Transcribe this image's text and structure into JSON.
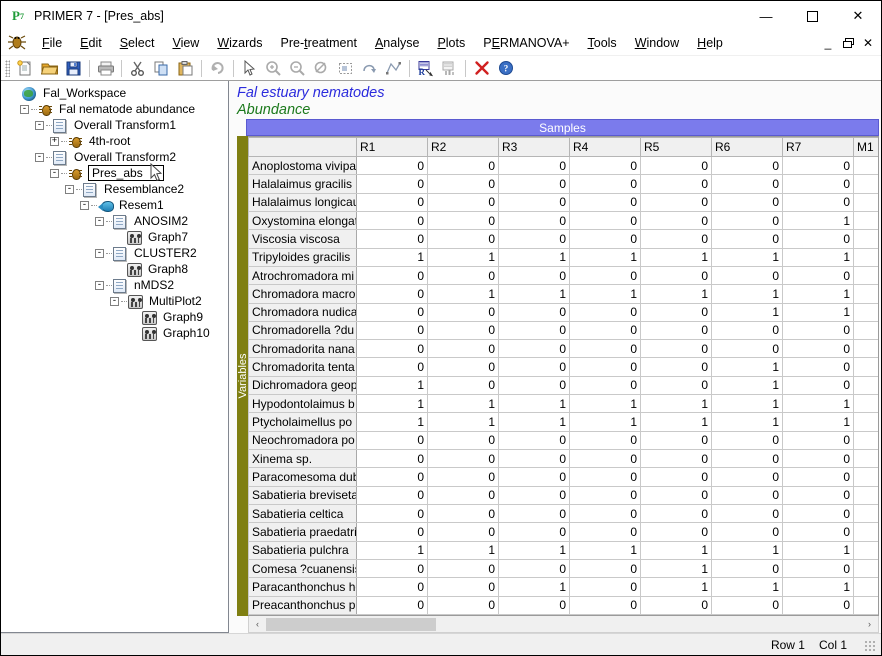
{
  "window": {
    "title": "PRIMER 7 - [Pres_abs]",
    "logo_text": "P",
    "logo_sub": "7",
    "minimize": "—",
    "maximize": "☐",
    "close": "✕"
  },
  "menubar": {
    "items": [
      {
        "pre": "",
        "accel": "F",
        "post": "ile",
        "name": "file"
      },
      {
        "pre": "",
        "accel": "E",
        "post": "dit",
        "name": "edit"
      },
      {
        "pre": "",
        "accel": "S",
        "post": "elect",
        "name": "select"
      },
      {
        "pre": "",
        "accel": "V",
        "post": "iew",
        "name": "view"
      },
      {
        "pre": "",
        "accel": "W",
        "post": "izards",
        "name": "wizards"
      },
      {
        "pre": "Pre-",
        "accel": "t",
        "post": "reatment",
        "name": "pre-treatment"
      },
      {
        "pre": "",
        "accel": "A",
        "post": "nalyse",
        "name": "analyse"
      },
      {
        "pre": "",
        "accel": "P",
        "post": "lots",
        "name": "plots"
      },
      {
        "pre": "P",
        "accel": "E",
        "post": "RMANOVA+",
        "name": "permanova"
      },
      {
        "pre": "",
        "accel": "T",
        "post": "ools",
        "name": "tools"
      },
      {
        "pre": "",
        "accel": "W",
        "post": "indow",
        "name": "window"
      },
      {
        "pre": "",
        "accel": "H",
        "post": "elp",
        "name": "help"
      }
    ],
    "mdi_minimize": "_",
    "mdi_restore": "❐",
    "mdi_close": "✕"
  },
  "toolbar": {
    "buttons": [
      {
        "name": "new-icon",
        "label": "New"
      },
      {
        "name": "open-icon",
        "label": "Open"
      },
      {
        "name": "save-icon",
        "label": "Save"
      },
      {
        "name": "print-icon",
        "label": "Print"
      },
      {
        "name": "cut-icon",
        "label": "Cut"
      },
      {
        "name": "copy-icon",
        "label": "Copy"
      },
      {
        "name": "paste-icon",
        "label": "Paste"
      },
      {
        "name": "undo-icon",
        "label": "Undo"
      },
      {
        "name": "pointer-icon",
        "label": "Select"
      },
      {
        "name": "zoom-in-icon",
        "label": "Zoom In"
      },
      {
        "name": "zoom-out-icon",
        "label": "Zoom Out"
      },
      {
        "name": "zoom-reset-icon",
        "label": "Zoom Reset"
      },
      {
        "name": "select-region-icon",
        "label": "Select Region"
      },
      {
        "name": "rotate-icon",
        "label": "Rotate"
      },
      {
        "name": "reshape-icon",
        "label": "Reshape"
      },
      {
        "name": "relabel-icon",
        "label": "Relabel"
      },
      {
        "name": "chart-icon",
        "label": "Chart"
      },
      {
        "name": "delete-icon",
        "label": "Delete"
      },
      {
        "name": "help-icon",
        "label": "Help"
      }
    ]
  },
  "tree": {
    "nodes": [
      {
        "label": "Fal_Workspace",
        "depth": 0,
        "icon": "globe",
        "expander": "",
        "selected": false
      },
      {
        "label": "Fal nematode abundance",
        "depth": 1,
        "icon": "bug",
        "expander": "-",
        "selected": false
      },
      {
        "label": "Overall Transform1",
        "depth": 2,
        "icon": "sheet",
        "expander": "-",
        "selected": false
      },
      {
        "label": "4th-root",
        "depth": 3,
        "icon": "bug",
        "expander": "+",
        "selected": false
      },
      {
        "label": "Overall Transform2",
        "depth": 2,
        "icon": "sheet",
        "expander": "-",
        "selected": false
      },
      {
        "label": "Pres_abs",
        "depth": 3,
        "icon": "bug",
        "expander": "-",
        "selected": true
      },
      {
        "label": "Resemblance2",
        "depth": 4,
        "icon": "sheet",
        "expander": "-",
        "selected": false
      },
      {
        "label": "Resem1",
        "depth": 5,
        "icon": "fish",
        "expander": "-",
        "selected": false
      },
      {
        "label": "ANOSIM2",
        "depth": 6,
        "icon": "sheet",
        "expander": "-",
        "selected": false
      },
      {
        "label": "Graph7",
        "depth": 7,
        "icon": "graph",
        "expander": "",
        "selected": false
      },
      {
        "label": "CLUSTER2",
        "depth": 6,
        "icon": "sheet",
        "expander": "-",
        "selected": false
      },
      {
        "label": "Graph8",
        "depth": 7,
        "icon": "graph",
        "expander": "",
        "selected": false
      },
      {
        "label": "nMDS2",
        "depth": 6,
        "icon": "sheet",
        "expander": "-",
        "selected": false
      },
      {
        "label": "MultiPlot2",
        "depth": 7,
        "icon": "graph",
        "expander": "-",
        "selected": false
      },
      {
        "label": "Graph9",
        "depth": 8,
        "icon": "graph",
        "expander": "",
        "selected": false
      },
      {
        "label": "Graph10",
        "depth": 8,
        "icon": "graph",
        "expander": "",
        "selected": false
      }
    ]
  },
  "document": {
    "title": "Fal estuary nematodes",
    "subtitle": "Abundance",
    "title_color": "#2b2bdd",
    "subtitle_color": "#1d7a1d"
  },
  "grid": {
    "samples_band_label": "Samples",
    "variables_label": "Variables",
    "band_color": "#7b7bec",
    "variables_color": "#7f7f12",
    "corner_header": "",
    "columns": [
      "R1",
      "R2",
      "R3",
      "R4",
      "R5",
      "R6",
      "R7",
      "M1"
    ],
    "rows": [
      {
        "label": "Anoplostoma vivipa",
        "values": [
          "0",
          "0",
          "0",
          "0",
          "0",
          "0",
          "0",
          ""
        ]
      },
      {
        "label": "Halalaimus gracilis",
        "values": [
          "0",
          "0",
          "0",
          "0",
          "0",
          "0",
          "0",
          ""
        ]
      },
      {
        "label": "Halalaimus longicau",
        "values": [
          "0",
          "0",
          "0",
          "0",
          "0",
          "0",
          "0",
          ""
        ]
      },
      {
        "label": "Oxystomina elongat",
        "values": [
          "0",
          "0",
          "0",
          "0",
          "0",
          "0",
          "1",
          ""
        ]
      },
      {
        "label": "Viscosia viscosa",
        "values": [
          "0",
          "0",
          "0",
          "0",
          "0",
          "0",
          "0",
          ""
        ]
      },
      {
        "label": "Tripyloides gracilis",
        "values": [
          "1",
          "1",
          "1",
          "1",
          "1",
          "1",
          "1",
          ""
        ]
      },
      {
        "label": "Atrochromadora mi",
        "values": [
          "0",
          "0",
          "0",
          "0",
          "0",
          "0",
          "0",
          ""
        ]
      },
      {
        "label": "Chromadora macro",
        "values": [
          "0",
          "1",
          "1",
          "1",
          "1",
          "1",
          "1",
          ""
        ]
      },
      {
        "label": "Chromadora nudica",
        "values": [
          "0",
          "0",
          "0",
          "0",
          "0",
          "1",
          "1",
          ""
        ]
      },
      {
        "label": "Chromadorella ?du",
        "values": [
          "0",
          "0",
          "0",
          "0",
          "0",
          "0",
          "0",
          ""
        ]
      },
      {
        "label": "Chromadorita nana",
        "values": [
          "0",
          "0",
          "0",
          "0",
          "0",
          "0",
          "0",
          ""
        ]
      },
      {
        "label": "Chromadorita tenta",
        "values": [
          "0",
          "0",
          "0",
          "0",
          "0",
          "1",
          "0",
          ""
        ]
      },
      {
        "label": "Dichromadora geop",
        "values": [
          "1",
          "0",
          "0",
          "0",
          "0",
          "1",
          "0",
          ""
        ]
      },
      {
        "label": "Hypodontolaimus b",
        "values": [
          "1",
          "1",
          "1",
          "1",
          "1",
          "1",
          "1",
          ""
        ]
      },
      {
        "label": "Ptycholaimellus po",
        "values": [
          "1",
          "1",
          "1",
          "1",
          "1",
          "1",
          "1",
          ""
        ]
      },
      {
        "label": "Neochromadora po",
        "values": [
          "0",
          "0",
          "0",
          "0",
          "0",
          "0",
          "0",
          ""
        ]
      },
      {
        "label": "Xinema sp.",
        "values": [
          "0",
          "0",
          "0",
          "0",
          "0",
          "0",
          "0",
          ""
        ]
      },
      {
        "label": "Paracomesoma dub",
        "values": [
          "0",
          "0",
          "0",
          "0",
          "0",
          "0",
          "0",
          ""
        ]
      },
      {
        "label": "Sabatieria breviseta",
        "values": [
          "0",
          "0",
          "0",
          "0",
          "0",
          "0",
          "0",
          ""
        ]
      },
      {
        "label": "Sabatieria celtica",
        "values": [
          "0",
          "0",
          "0",
          "0",
          "0",
          "0",
          "0",
          ""
        ]
      },
      {
        "label": "Sabatieria praedatri",
        "values": [
          "0",
          "0",
          "0",
          "0",
          "0",
          "0",
          "0",
          ""
        ]
      },
      {
        "label": "Sabatieria pulchra",
        "values": [
          "1",
          "1",
          "1",
          "1",
          "1",
          "1",
          "1",
          ""
        ]
      },
      {
        "label": "Comesa ?cuanensis",
        "values": [
          "0",
          "0",
          "0",
          "0",
          "1",
          "0",
          "0",
          ""
        ]
      },
      {
        "label": "Paracanthonchus he",
        "values": [
          "0",
          "0",
          "1",
          "0",
          "1",
          "1",
          "1",
          ""
        ]
      },
      {
        "label": "Preacanthonchus pu",
        "values": [
          "0",
          "0",
          "0",
          "0",
          "0",
          "0",
          "0",
          ""
        ]
      }
    ]
  },
  "scrollbars": {
    "up_arrow": "⌃",
    "down_arrow": "⌄",
    "left_arrow": "‹",
    "right_arrow": "›"
  },
  "statusbar": {
    "row": "Row 1",
    "col": "Col 1"
  }
}
